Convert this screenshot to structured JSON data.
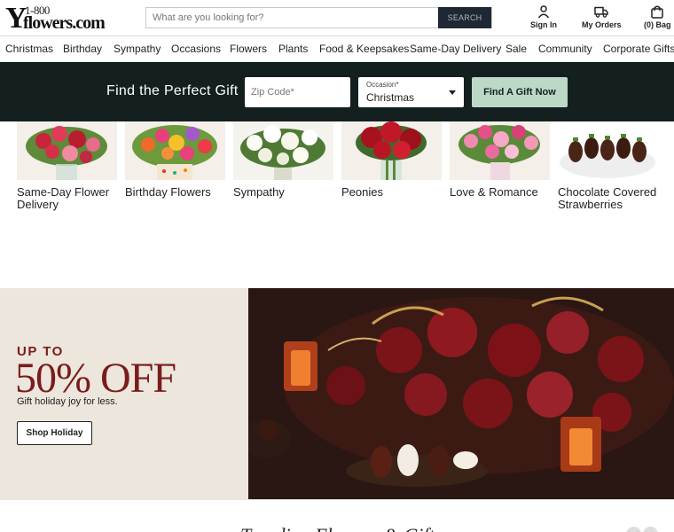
{
  "header": {
    "logo_top": "1-800",
    "logo_main": "flowers.com",
    "search_placeholder": "What are you looking for?",
    "search_button": "SEARCH",
    "sign_in": "Sign In",
    "my_orders": "My Orders",
    "bag": "(0) Bag"
  },
  "nav": [
    "Christmas",
    "Birthday",
    "Sympathy",
    "Occasions",
    "Flowers",
    "Plants",
    "Food & Keepsakes",
    "Same-Day Delivery",
    "Sale",
    "Community",
    "Corporate Gifts"
  ],
  "finder": {
    "title": "Find the Perfect Gift",
    "zip_placeholder": "Zip Code*",
    "occasion_label": "Occasion*",
    "occasion_value": "Christmas",
    "button": "Find A Gift Now"
  },
  "categories": [
    {
      "label": "Same-Day Flower Delivery"
    },
    {
      "label": "Birthday Flowers"
    },
    {
      "label": "Sympathy"
    },
    {
      "label": "Peonies"
    },
    {
      "label": "Love & Romance"
    },
    {
      "label": "Chocolate Covered Strawberries"
    }
  ],
  "promo": {
    "kicker": "UP TO",
    "headline": "50% OFF",
    "subtitle": "Gift holiday joy for less.",
    "button": "Shop Holiday"
  },
  "trending_title": "Trending Flowers & Gifts"
}
